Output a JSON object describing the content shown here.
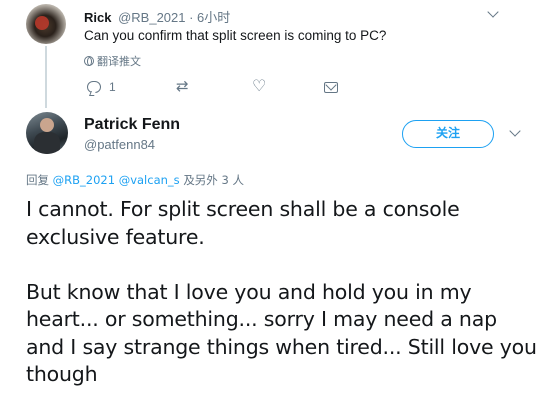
{
  "reply_tweet": {
    "author_name": "Rick",
    "author_handle_time": "@RB_2021 · 6小时",
    "text": "Can you confirm that split screen is coming to PC?",
    "translate_label": "翻译推文",
    "reply_count": "1"
  },
  "main_tweet": {
    "author_name": "Patrick Fenn",
    "author_handle": "@patfenn84",
    "follow_label": "关注",
    "replying_prefix": "回复",
    "replying_mentions": "@RB_2021 @valcan_s",
    "replying_suffix": "及另外 3 人",
    "text": "I cannot. For split screen shall be a console exclusive feature.\n\nBut know that I love you and hold you in my heart... or something... sorry  I may need a nap and I say strange things when tired... Still love you though"
  },
  "colors": {
    "accent": "#1da1f2",
    "secondary_text": "#657786",
    "primary_text": "#14171a"
  },
  "icons": {
    "reply": "reply-bubble-icon",
    "retweet": "retweet-icon",
    "like": "heart-icon",
    "message": "mail-icon",
    "translate": "globe-icon",
    "more": "chevron-down-icon"
  }
}
